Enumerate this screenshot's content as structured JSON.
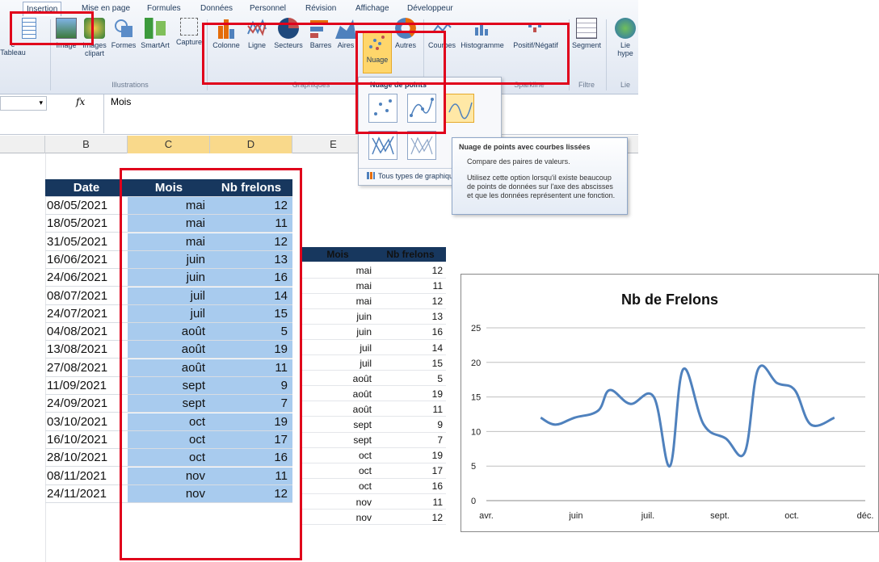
{
  "ribbon": {
    "tabs": [
      "Insertion",
      "Mise en page",
      "Formules",
      "Données",
      "Personnel",
      "Révision",
      "Affichage",
      "Développeur"
    ],
    "active_tab": "Insertion",
    "buttons": {
      "tableau": "e Tableau",
      "image": "Image",
      "images_clipart": "Images clipart",
      "formes": "Formes",
      "smartart": "SmartArt",
      "capture": "Capture",
      "colonne": "Colonne",
      "ligne": "Ligne",
      "secteurs": "Secteurs",
      "barres": "Barres",
      "aires": "Aires",
      "nuage": "Nuage",
      "autres": "Autres",
      "courbes": "Courbes",
      "histogramme": "Histogramme",
      "positif_negatif": "Positif/Négatif",
      "segment": "Segment",
      "lien": "Lie",
      "lien2": "hype"
    },
    "groups": {
      "illustrations": "Illustrations",
      "graphiques": "Graphiques",
      "sparkline": "Sparkline",
      "filtre": "Filtre",
      "liens": "Lie"
    }
  },
  "formula_bar": {
    "fx": "fx",
    "value": "Mois"
  },
  "columns": [
    "B",
    "C",
    "D",
    "E"
  ],
  "dropdown": {
    "section_title": "Nuage de points",
    "all_types": "Tous types de graphiques"
  },
  "tooltip": {
    "title": "Nuage de points avec courbes lissées",
    "line1": "Compare des paires de valeurs.",
    "body": "Utilisez cette option lorsqu'il existe beaucoup de points de données sur l'axe des abscisses et que les données représentent une fonction."
  },
  "main_table": {
    "headers": [
      "Date",
      "Mois",
      "Nb frelons"
    ],
    "rows": [
      [
        "08/05/2021",
        "mai",
        "12"
      ],
      [
        "18/05/2021",
        "mai",
        "11"
      ],
      [
        "31/05/2021",
        "mai",
        "12"
      ],
      [
        "16/06/2021",
        "juin",
        "13"
      ],
      [
        "24/06/2021",
        "juin",
        "16"
      ],
      [
        "08/07/2021",
        "juil",
        "14"
      ],
      [
        "24/07/2021",
        "juil",
        "15"
      ],
      [
        "04/08/2021",
        "août",
        "5"
      ],
      [
        "13/08/2021",
        "août",
        "19"
      ],
      [
        "27/08/2021",
        "août",
        "11"
      ],
      [
        "11/09/2021",
        "sept",
        "9"
      ],
      [
        "24/09/2021",
        "sept",
        "7"
      ],
      [
        "03/10/2021",
        "oct",
        "19"
      ],
      [
        "16/10/2021",
        "oct",
        "17"
      ],
      [
        "28/10/2021",
        "oct",
        "16"
      ],
      [
        "08/11/2021",
        "nov",
        "11"
      ],
      [
        "24/11/2021",
        "nov",
        "12"
      ]
    ]
  },
  "copy_table": {
    "headers": [
      "Mois",
      "Nb frelons"
    ],
    "rows": [
      [
        "mai",
        "12"
      ],
      [
        "mai",
        "11"
      ],
      [
        "mai",
        "12"
      ],
      [
        "juin",
        "13"
      ],
      [
        "juin",
        "16"
      ],
      [
        "juil",
        "14"
      ],
      [
        "juil",
        "15"
      ],
      [
        "août",
        "5"
      ],
      [
        "août",
        "19"
      ],
      [
        "août",
        "11"
      ],
      [
        "sept",
        "9"
      ],
      [
        "sept",
        "7"
      ],
      [
        "oct",
        "19"
      ],
      [
        "oct",
        "17"
      ],
      [
        "oct",
        "16"
      ],
      [
        "nov",
        "11"
      ],
      [
        "nov",
        "12"
      ]
    ]
  },
  "chart_data": {
    "type": "line",
    "title": "Nb de Frelons",
    "smoothed": true,
    "x": [
      "2021-05-08",
      "2021-05-18",
      "2021-05-31",
      "2021-06-16",
      "2021-06-24",
      "2021-07-08",
      "2021-07-24",
      "2021-08-04",
      "2021-08-13",
      "2021-08-27",
      "2021-09-11",
      "2021-09-24",
      "2021-10-03",
      "2021-10-16",
      "2021-10-28",
      "2021-11-08",
      "2021-11-24"
    ],
    "values": [
      12,
      11,
      12,
      13,
      16,
      14,
      15,
      5,
      19,
      11,
      9,
      7,
      19,
      17,
      16,
      11,
      12
    ],
    "x_tick_labels": [
      "avr.",
      "juin",
      "juil.",
      "sept.",
      "oct.",
      "déc."
    ],
    "y_ticks": [
      "0",
      "5",
      "10",
      "15",
      "20",
      "25"
    ],
    "ylim": [
      0,
      25
    ],
    "grid": true,
    "color": "#4f81bd"
  },
  "colors": {
    "header": "#17375e",
    "selection": "#a8cbee",
    "highlight": "#e0001b",
    "series": "#4f81bd"
  }
}
